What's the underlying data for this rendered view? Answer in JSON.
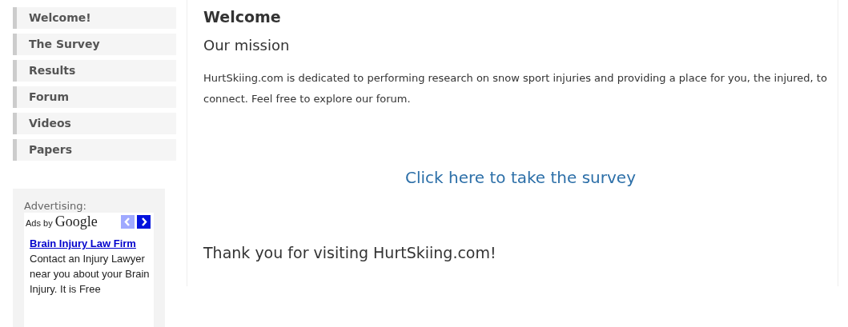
{
  "nav": [
    {
      "label": "Welcome!"
    },
    {
      "label": "The Survey"
    },
    {
      "label": "Results"
    },
    {
      "label": "Forum"
    },
    {
      "label": "Videos"
    },
    {
      "label": "Papers"
    }
  ],
  "ad_box": {
    "heading": "Advertising:",
    "ads_by": "Ads by",
    "brand": "Google",
    "ad_title": "Brain Injury Law Firm",
    "ad_text": "Contact an Injury Lawyer near you about your Brain Injury. It is Free"
  },
  "main": {
    "title": "Welcome",
    "subtitle": "Our mission",
    "paragraph": "HurtSkiing.com is dedicated to performing research on snow sport injuries and providing a place for you, the injured, to connect. Feel free to explore our forum.",
    "survey_link": "Click here to take the survey",
    "thanks": "Thank you for visiting HurtSkiing.com!"
  }
}
